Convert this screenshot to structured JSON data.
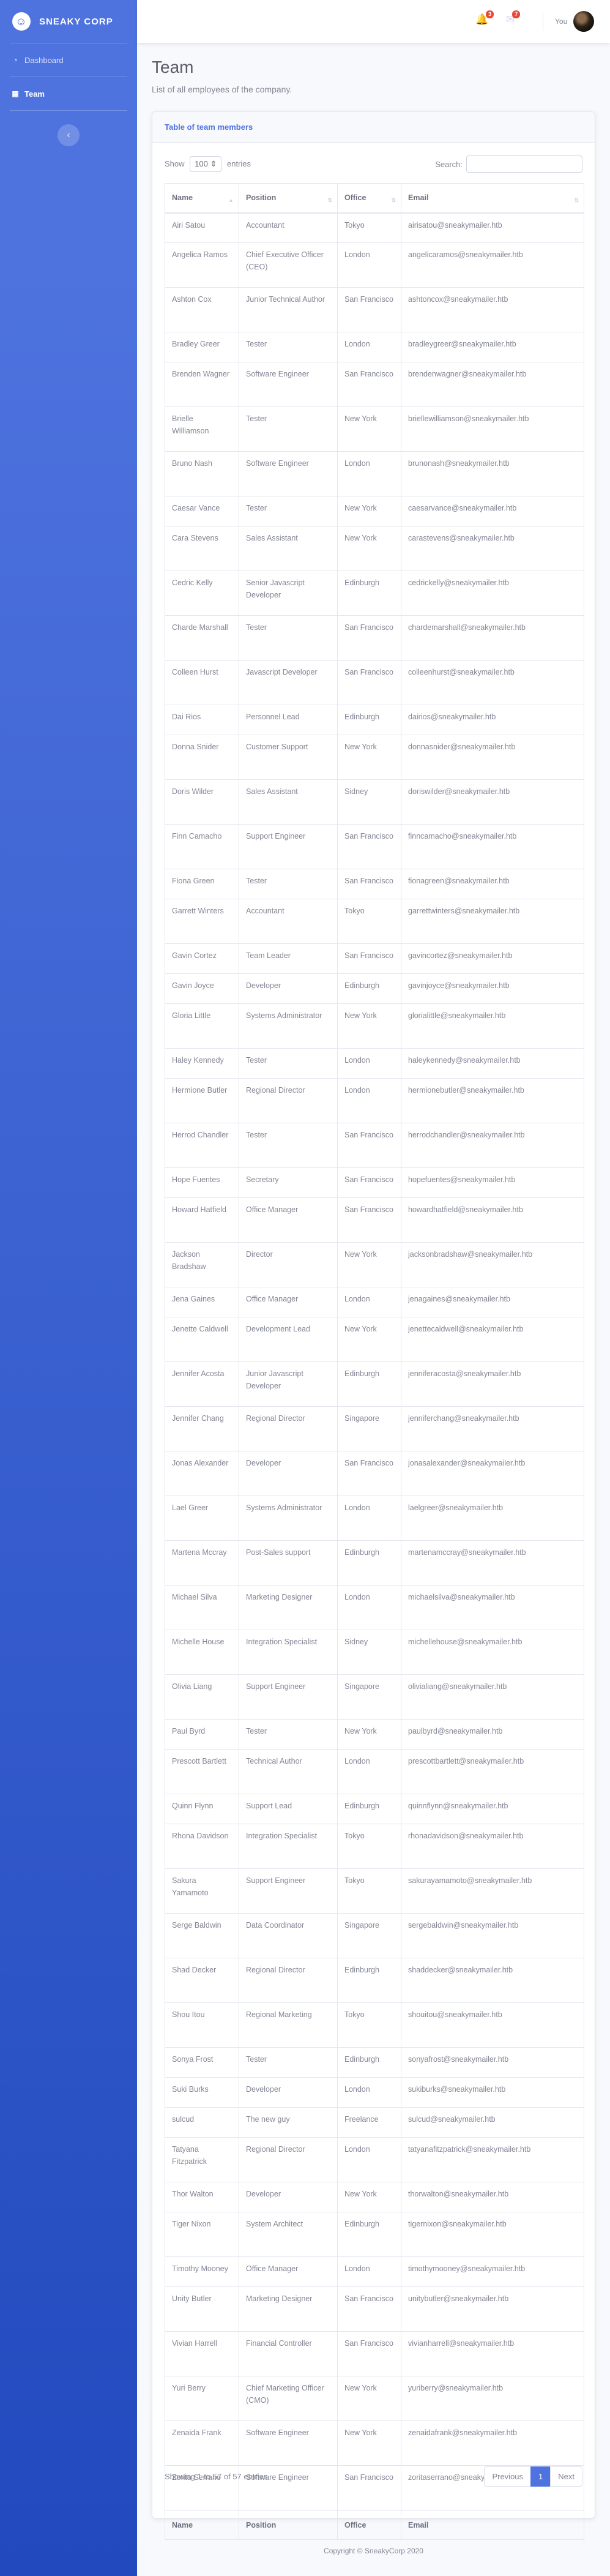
{
  "brand": {
    "name": "SNEAKY CORP",
    "logo_glyph": "☺"
  },
  "sidebar": {
    "items": [
      {
        "label": "Dashboard",
        "icon": "dashboard-icon",
        "glyph": "◔"
      },
      {
        "label": "Team",
        "icon": "table-icon",
        "glyph": "▦"
      }
    ],
    "toggle_glyph": "‹"
  },
  "topbar": {
    "alerts": {
      "icon": "bell-icon",
      "glyph": "🔔",
      "count": "3"
    },
    "messages": {
      "icon": "envelope-icon",
      "glyph": "✉",
      "count": "7"
    },
    "user_name": "You"
  },
  "page": {
    "title": "Team",
    "description": "List of all employees of the company."
  },
  "card": {
    "title": "Table of team members",
    "show_label": "Show",
    "entries_value": "100",
    "entries_label": "entries",
    "search_label": "Search:",
    "search_value": ""
  },
  "table": {
    "headers": [
      "Name",
      "Position",
      "Office",
      "Email"
    ],
    "rows": [
      [
        "Airi Satou",
        "Accountant",
        "Tokyo",
        "airisatou@sneakymailer.htb"
      ],
      [
        "Angelica Ramos",
        "Chief Executive Officer (CEO)",
        "London",
        "angelicaramos@sneakymailer.htb"
      ],
      [
        "Ashton Cox",
        "Junior Technical Author",
        "San Francisco",
        "ashtoncox@sneakymailer.htb"
      ],
      [
        "Bradley Greer",
        "Tester",
        "London",
        "bradleygreer@sneakymailer.htb"
      ],
      [
        "Brenden Wagner",
        "Software Engineer",
        "San Francisco",
        "brendenwagner@sneakymailer.htb"
      ],
      [
        "Brielle Williamson",
        "Tester",
        "New York",
        "briellewilliamson@sneakymailer.htb"
      ],
      [
        "Bruno Nash",
        "Software Engineer",
        "London",
        "brunonash@sneakymailer.htb"
      ],
      [
        "Caesar Vance",
        "Tester",
        "New York",
        "caesarvance@sneakymailer.htb"
      ],
      [
        "Cara Stevens",
        "Sales Assistant",
        "New York",
        "carastevens@sneakymailer.htb"
      ],
      [
        "Cedric Kelly",
        "Senior Javascript Developer",
        "Edinburgh",
        "cedrickelly@sneakymailer.htb"
      ],
      [
        "Charde Marshall",
        "Tester",
        "San Francisco",
        "chardemarshall@sneakymailer.htb"
      ],
      [
        "Colleen Hurst",
        "Javascript Developer",
        "San Francisco",
        "colleenhurst@sneakymailer.htb"
      ],
      [
        "Dai Rios",
        "Personnel Lead",
        "Edinburgh",
        "dairios@sneakymailer.htb"
      ],
      [
        "Donna Snider",
        "Customer Support",
        "New York",
        "donnasnider@sneakymailer.htb"
      ],
      [
        "Doris Wilder",
        "Sales Assistant",
        "Sidney",
        "doriswilder@sneakymailer.htb"
      ],
      [
        "Finn Camacho",
        "Support Engineer",
        "San Francisco",
        "finncamacho@sneakymailer.htb"
      ],
      [
        "Fiona Green",
        "Tester",
        "San Francisco",
        "fionagreen@sneakymailer.htb"
      ],
      [
        "Garrett Winters",
        "Accountant",
        "Tokyo",
        "garrettwinters@sneakymailer.htb"
      ],
      [
        "Gavin Cortez",
        "Team Leader",
        "San Francisco",
        "gavincortez@sneakymailer.htb"
      ],
      [
        "Gavin Joyce",
        "Developer",
        "Edinburgh",
        "gavinjoyce@sneakymailer.htb"
      ],
      [
        "Gloria Little",
        "Systems Administrator",
        "New York",
        "glorialittle@sneakymailer.htb"
      ],
      [
        "Haley Kennedy",
        "Tester",
        "London",
        "haleykennedy@sneakymailer.htb"
      ],
      [
        "Hermione Butler",
        "Regional Director",
        "London",
        "hermionebutler@sneakymailer.htb"
      ],
      [
        "Herrod Chandler",
        "Tester",
        "San Francisco",
        "herrodchandler@sneakymailer.htb"
      ],
      [
        "Hope Fuentes",
        "Secretary",
        "San Francisco",
        "hopefuentes@sneakymailer.htb"
      ],
      [
        "Howard Hatfield",
        "Office Manager",
        "San Francisco",
        "howardhatfield@sneakymailer.htb"
      ],
      [
        "Jackson Bradshaw",
        "Director",
        "New York",
        "jacksonbradshaw@sneakymailer.htb"
      ],
      [
        "Jena Gaines",
        "Office Manager",
        "London",
        "jenagaines@sneakymailer.htb"
      ],
      [
        "Jenette Caldwell",
        "Development Lead",
        "New York",
        "jenettecaldwell@sneakymailer.htb"
      ],
      [
        "Jennifer Acosta",
        "Junior Javascript Developer",
        "Edinburgh",
        "jenniferacosta@sneakymailer.htb"
      ],
      [
        "Jennifer Chang",
        "Regional Director",
        "Singapore",
        "jenniferchang@sneakymailer.htb"
      ],
      [
        "Jonas Alexander",
        "Developer",
        "San Francisco",
        "jonasalexander@sneakymailer.htb"
      ],
      [
        "Lael Greer",
        "Systems Administrator",
        "London",
        "laelgreer@sneakymailer.htb"
      ],
      [
        "Martena Mccray",
        "Post-Sales support",
        "Edinburgh",
        "martenamccray@sneakymailer.htb"
      ],
      [
        "Michael Silva",
        "Marketing Designer",
        "London",
        "michaelsilva@sneakymailer.htb"
      ],
      [
        "Michelle House",
        "Integration Specialist",
        "Sidney",
        "michellehouse@sneakymailer.htb"
      ],
      [
        "Olivia Liang",
        "Support Engineer",
        "Singapore",
        "olivialiang@sneakymailer.htb"
      ],
      [
        "Paul Byrd",
        "Tester",
        "New York",
        "paulbyrd@sneakymailer.htb"
      ],
      [
        "Prescott Bartlett",
        "Technical Author",
        "London",
        "prescottbartlett@sneakymailer.htb"
      ],
      [
        "Quinn Flynn",
        "Support Lead",
        "Edinburgh",
        "quinnflynn@sneakymailer.htb"
      ],
      [
        "Rhona Davidson",
        "Integration Specialist",
        "Tokyo",
        "rhonadavidson@sneakymailer.htb"
      ],
      [
        "Sakura Yamamoto",
        "Support Engineer",
        "Tokyo",
        "sakurayamamoto@sneakymailer.htb"
      ],
      [
        "Serge Baldwin",
        "Data Coordinator",
        "Singapore",
        "sergebaldwin@sneakymailer.htb"
      ],
      [
        "Shad Decker",
        "Regional Director",
        "Edinburgh",
        "shaddecker@sneakymailer.htb"
      ],
      [
        "Shou Itou",
        "Regional Marketing",
        "Tokyo",
        "shouitou@sneakymailer.htb"
      ],
      [
        "Sonya Frost",
        "Tester",
        "Edinburgh",
        "sonyafrost@sneakymailer.htb"
      ],
      [
        "Suki Burks",
        "Developer",
        "London",
        "sukiburks@sneakymailer.htb"
      ],
      [
        "sulcud",
        "The new guy",
        "Freelance",
        "sulcud@sneakymailer.htb"
      ],
      [
        "Tatyana Fitzpatrick",
        "Regional Director",
        "London",
        "tatyanafitzpatrick@sneakymailer.htb"
      ],
      [
        "Thor Walton",
        "Developer",
        "New York",
        "thorwalton@sneakymailer.htb"
      ],
      [
        "Tiger Nixon",
        "System Architect",
        "Edinburgh",
        "tigernixon@sneakymailer.htb"
      ],
      [
        "Timothy Mooney",
        "Office Manager",
        "London",
        "timothymooney@sneakymailer.htb"
      ],
      [
        "Unity Butler",
        "Marketing Designer",
        "San Francisco",
        "unitybutler@sneakymailer.htb"
      ],
      [
        "Vivian Harrell",
        "Financial Controller",
        "San Francisco",
        "vivianharrell@sneakymailer.htb"
      ],
      [
        "Yuri Berry",
        "Chief Marketing Officer (CMO)",
        "New York",
        "yuriberry@sneakymailer.htb"
      ],
      [
        "Zenaida Frank",
        "Software Engineer",
        "New York",
        "zenaidafrank@sneakymailer.htb"
      ],
      [
        "Zorita Serrano",
        "Software Engineer",
        "San Francisco",
        "zoritaserrano@sneakymailer.htb"
      ]
    ]
  },
  "table_footer": {
    "info": "Showing 1 to 57 of 57 entries",
    "previous": "Previous",
    "current_page": "1",
    "next": "Next"
  },
  "footer": {
    "copyright": "Copyright © SneakyCorp 2020"
  },
  "colors": {
    "primary": "#4e73df",
    "sidebar_dark": "#224abe",
    "badge": "#e74a3b",
    "text": "#858796"
  }
}
